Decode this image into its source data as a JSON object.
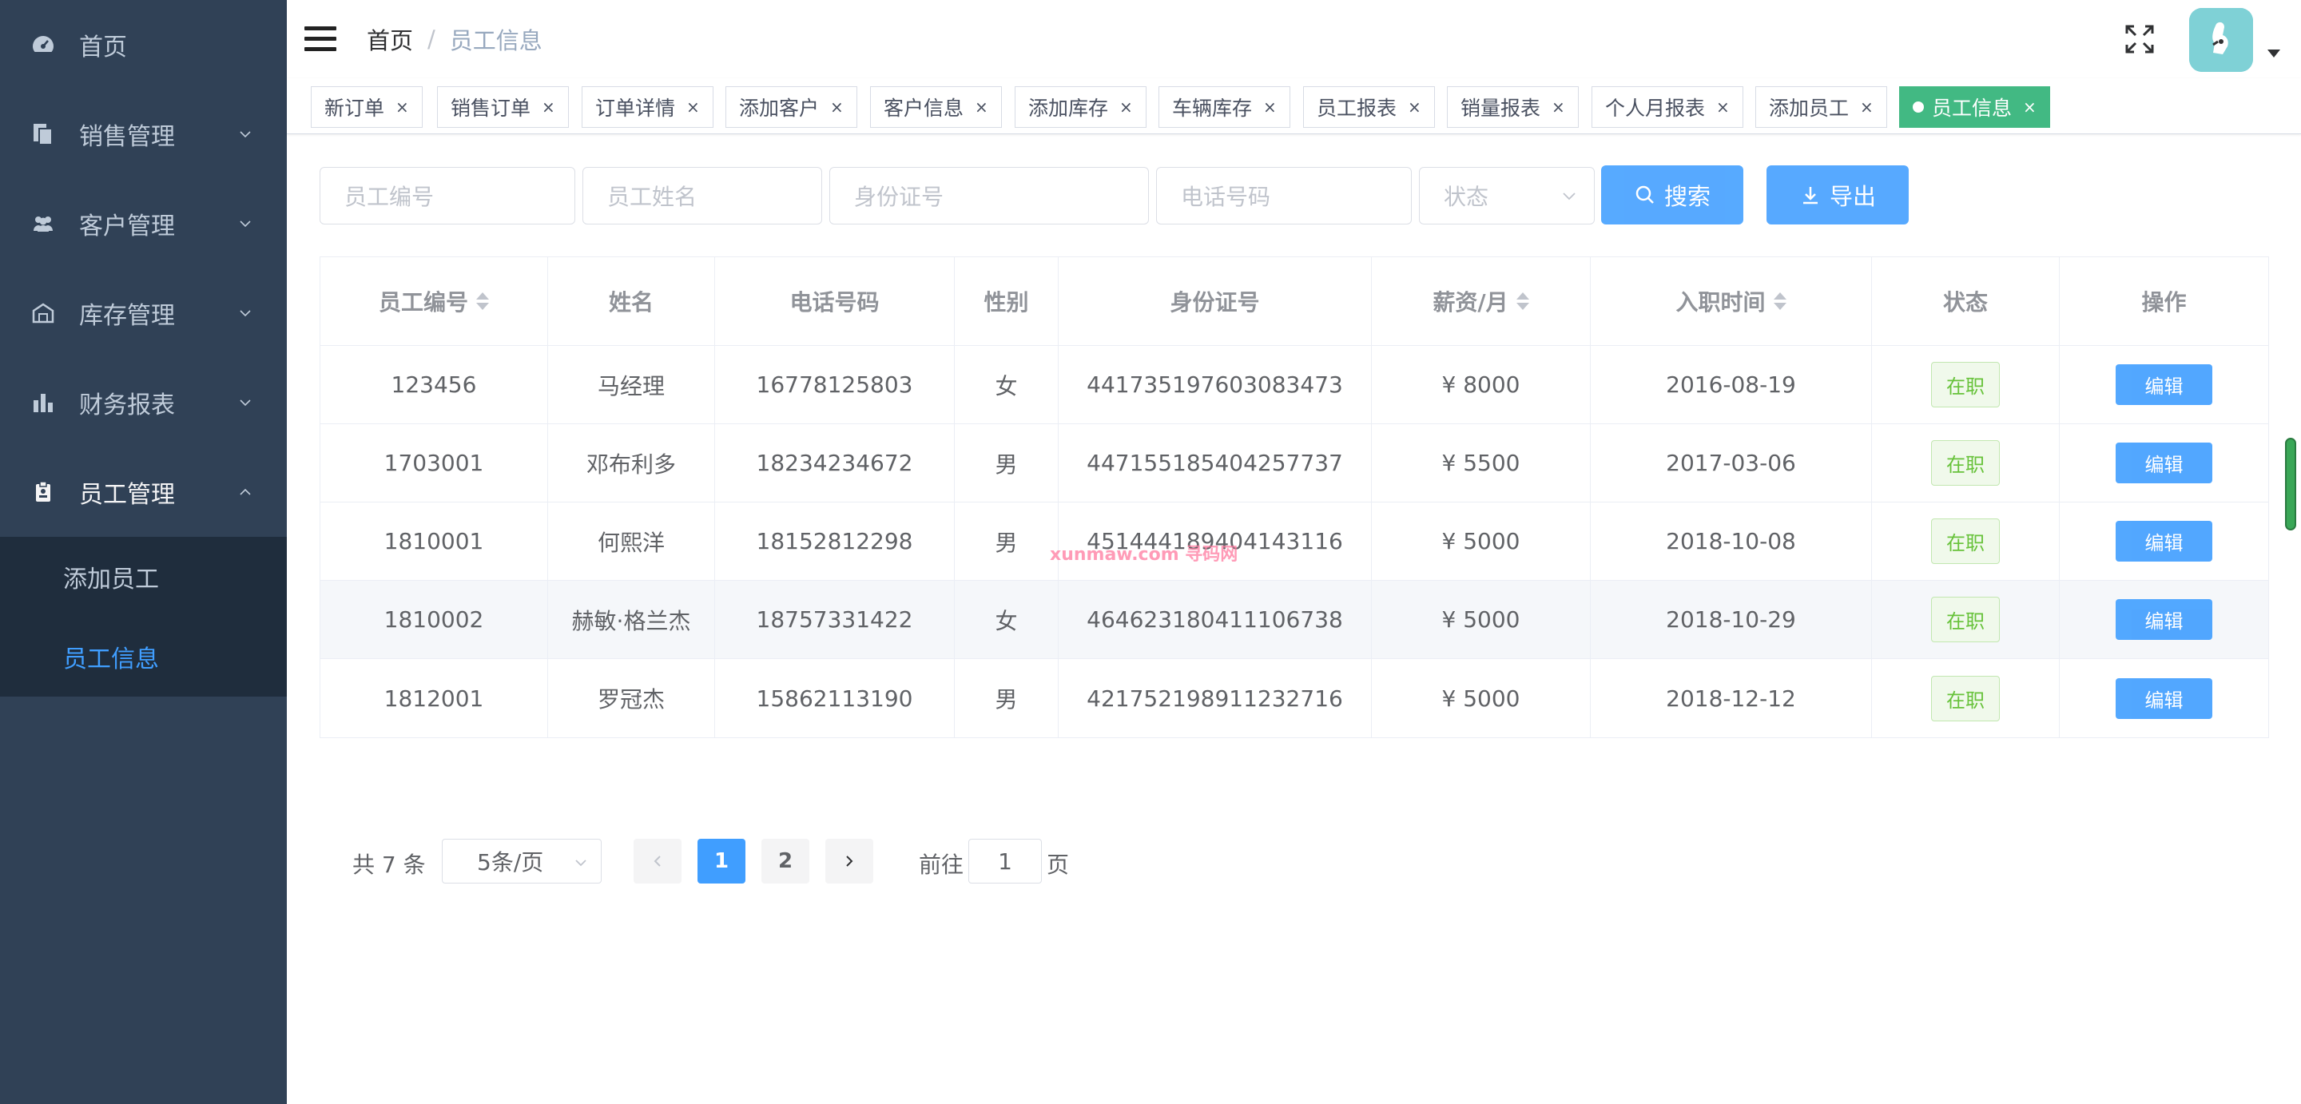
{
  "sidebar": {
    "items": [
      {
        "label": "首页",
        "icon": "dashboard-icon"
      },
      {
        "label": "销售管理",
        "icon": "document-icon"
      },
      {
        "label": "客户管理",
        "icon": "people-icon"
      },
      {
        "label": "库存管理",
        "icon": "warehouse-icon"
      },
      {
        "label": "财务报表",
        "icon": "bar-chart-icon"
      },
      {
        "label": "员工管理",
        "icon": "badge-icon"
      }
    ],
    "submenu": [
      {
        "label": "添加员工"
      },
      {
        "label": "员工信息"
      }
    ]
  },
  "navbar": {
    "breadcrumb": {
      "home": "首页",
      "separator": "/",
      "current": "员工信息"
    }
  },
  "tags": [
    {
      "label": "新订单",
      "close": "×"
    },
    {
      "label": "销售订单",
      "close": "×"
    },
    {
      "label": "订单详情",
      "close": "×"
    },
    {
      "label": "添加客户",
      "close": "×"
    },
    {
      "label": "客户信息",
      "close": "×"
    },
    {
      "label": "添加库存",
      "close": "×"
    },
    {
      "label": "车辆库存",
      "close": "×"
    },
    {
      "label": "员工报表",
      "close": "×"
    },
    {
      "label": "销量报表",
      "close": "×"
    },
    {
      "label": "个人月报表",
      "close": "×"
    },
    {
      "label": "添加员工",
      "close": "×"
    },
    {
      "label": "员工信息",
      "close": "×"
    }
  ],
  "filters": {
    "employee_id_placeholder": "员工编号",
    "name_placeholder": "员工姓名",
    "id_card_placeholder": "身份证号",
    "phone_placeholder": "电话号码",
    "status_placeholder": "状态",
    "search_label": "搜索",
    "export_label": "导出"
  },
  "table": {
    "headers": [
      "员工编号",
      "姓名",
      "电话号码",
      "性别",
      "身份证号",
      "薪资/月",
      "入职时间",
      "状态",
      "操作"
    ],
    "rows": [
      {
        "id": "123456",
        "name": "马经理",
        "phone": "16778125803",
        "gender": "女",
        "id_card": "441735197603083473",
        "salary": "¥ 8000",
        "hire_date": "2016-08-19",
        "status": "在职",
        "action": "编辑"
      },
      {
        "id": "1703001",
        "name": "邓布利多",
        "phone": "18234234672",
        "gender": "男",
        "id_card": "447155185404257737",
        "salary": "¥ 5500",
        "hire_date": "2017-03-06",
        "status": "在职",
        "action": "编辑"
      },
      {
        "id": "1810001",
        "name": "何熙洋",
        "phone": "18152812298",
        "gender": "男",
        "id_card": "451444189404143116",
        "salary": "¥ 5000",
        "hire_date": "2018-10-08",
        "status": "在职",
        "action": "编辑"
      },
      {
        "id": "1810002",
        "name": "赫敏·格兰杰",
        "phone": "18757331422",
        "gender": "女",
        "id_card": "464623180411106738",
        "salary": "¥ 5000",
        "hire_date": "2018-10-29",
        "status": "在职",
        "action": "编辑"
      },
      {
        "id": "1812001",
        "name": "罗冠杰",
        "phone": "15862113190",
        "gender": "男",
        "id_card": "421752198911232716",
        "salary": "¥ 5000",
        "hire_date": "2018-12-12",
        "status": "在职",
        "action": "编辑"
      }
    ]
  },
  "watermark": "xunmaw.com 寻码网",
  "pagination": {
    "total_text": "共 7 条",
    "page_size": "5条/页",
    "pages": [
      "1",
      "2"
    ],
    "goto_label": "前往",
    "goto_value": "1",
    "page_suffix": "页"
  },
  "colors": {
    "sidebar_bg": "#304156",
    "primary": "#409eff",
    "active_tag": "#42b983",
    "status_green": "#67c23a"
  }
}
